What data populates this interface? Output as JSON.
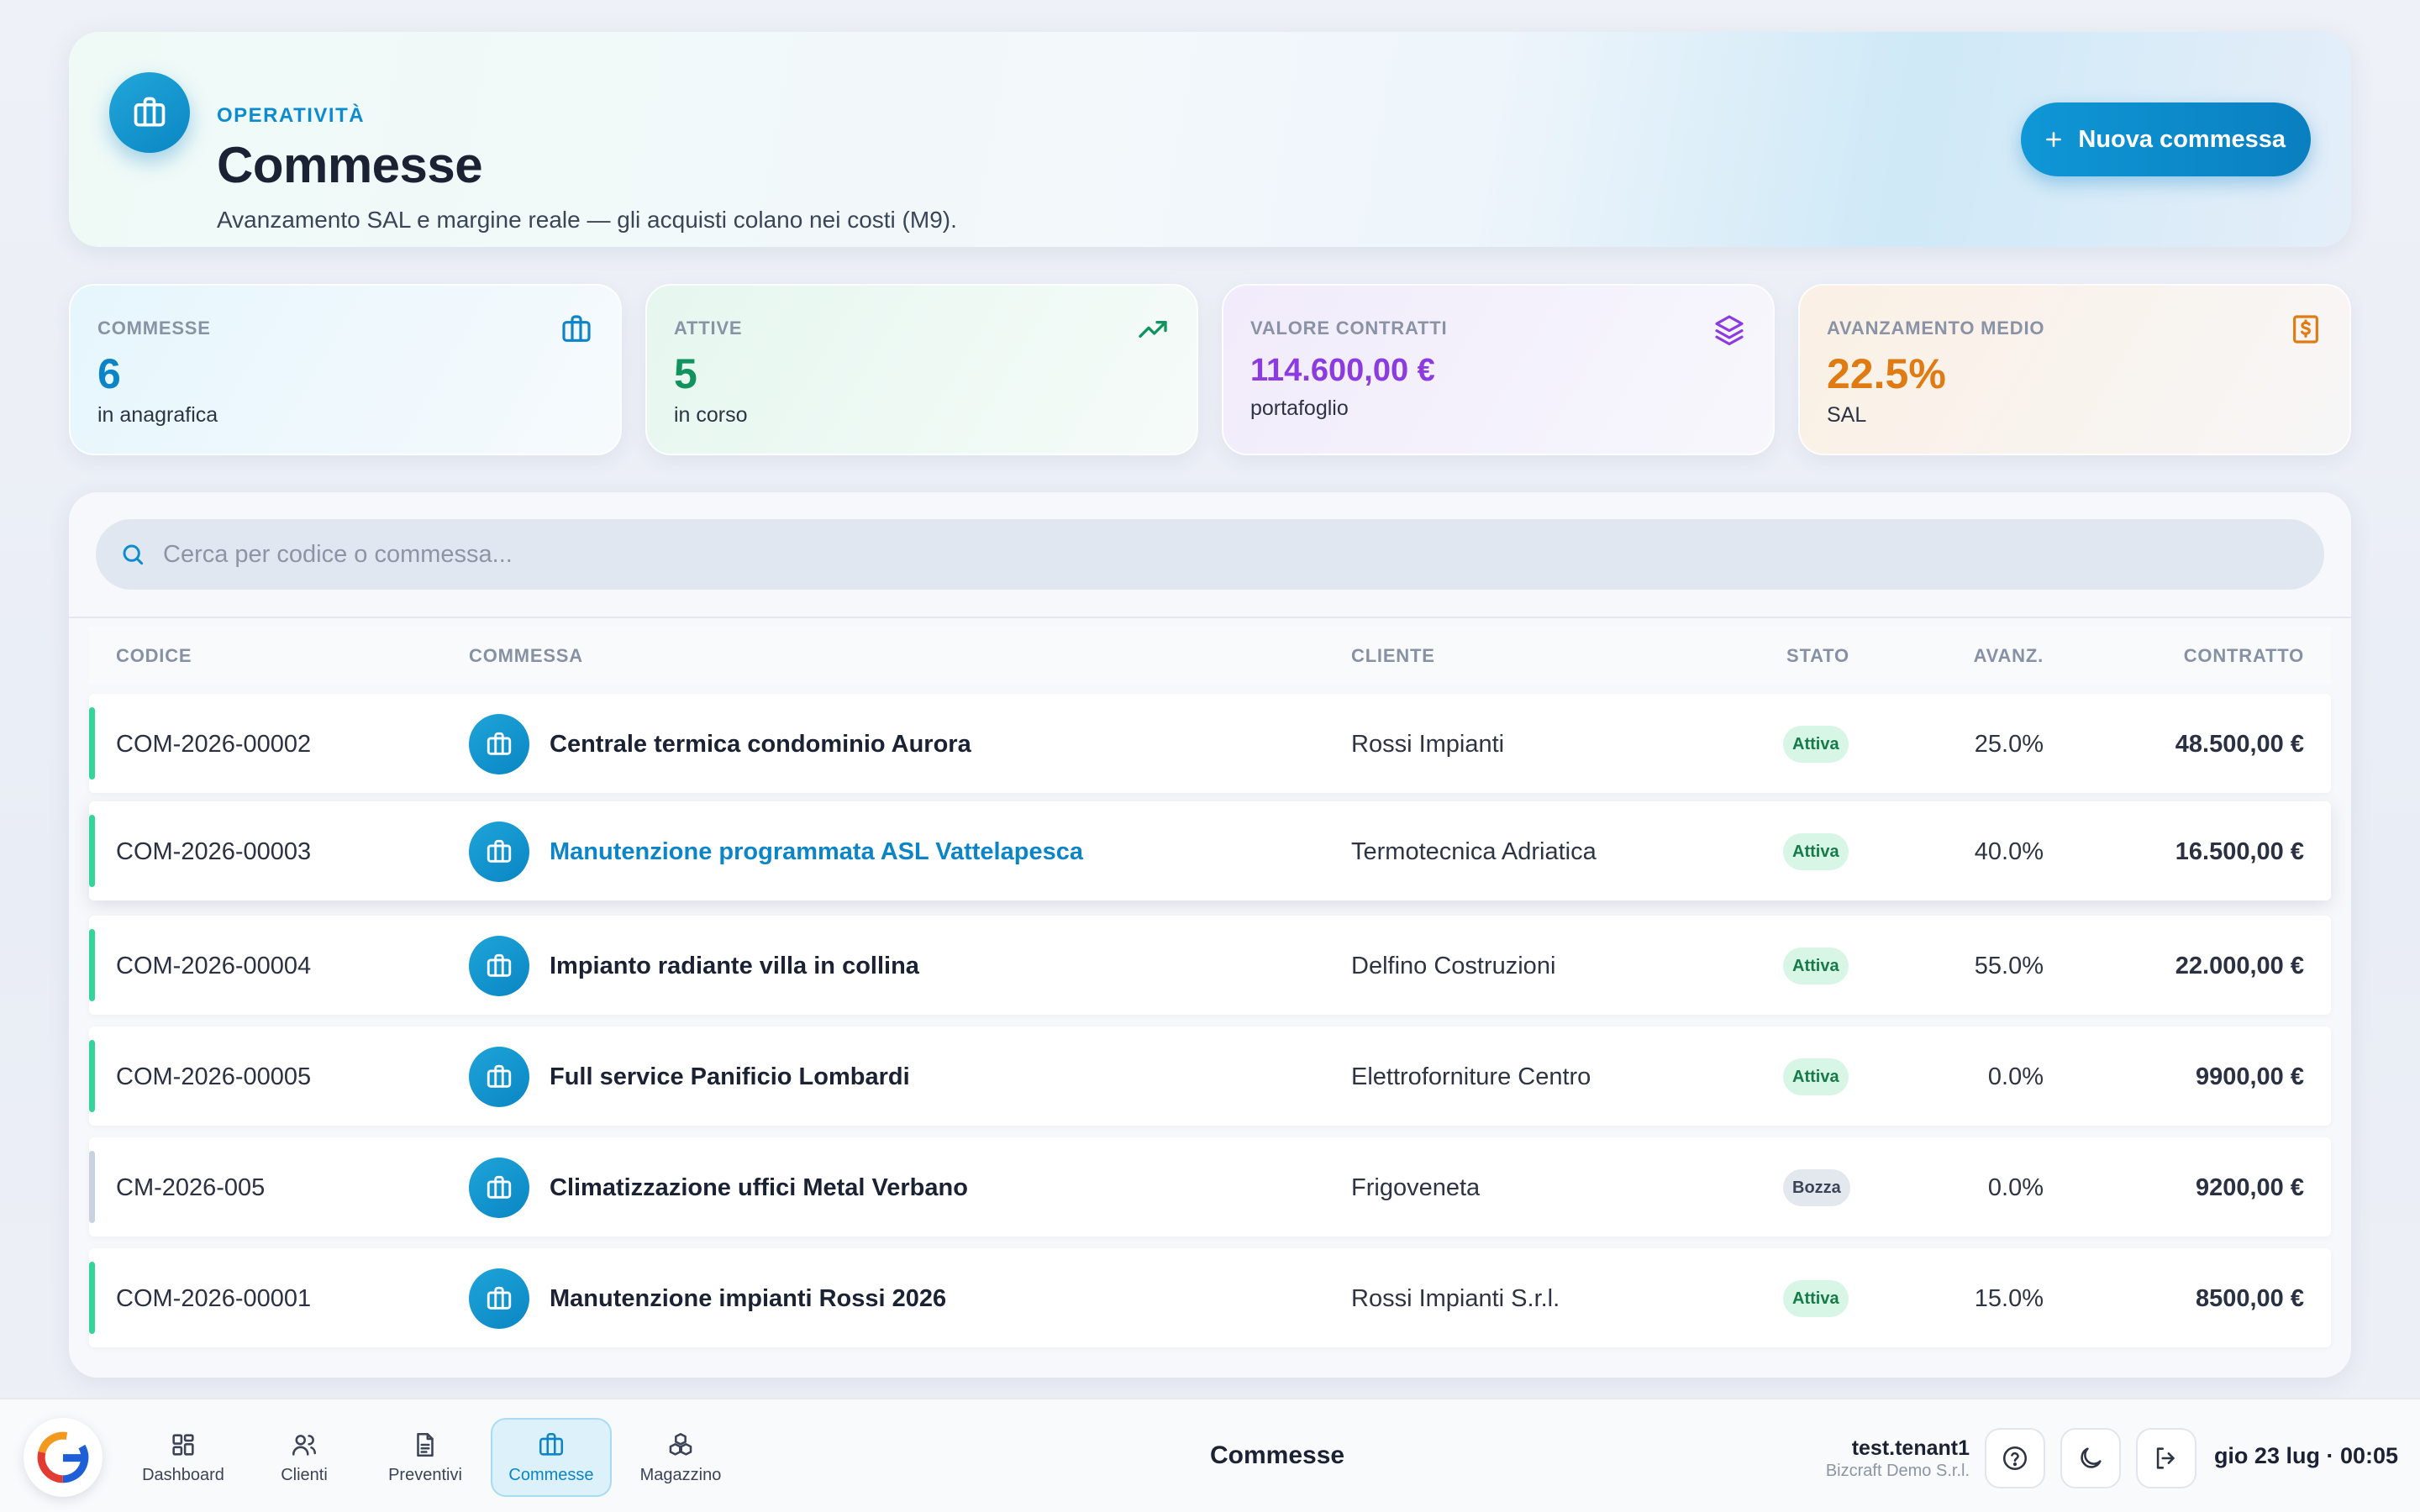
{
  "header": {
    "eyebrow": "OPERATIVITÀ",
    "title": "Commesse",
    "subtitle": "Avanzamento SAL e margine reale — gli acquisti colano nei costi (M9).",
    "new_button": "Nuova commessa",
    "icon": "briefcase-icon"
  },
  "kpis": [
    {
      "label": "COMMESSE",
      "value": "6",
      "sub": "in anagrafica",
      "icon": "briefcase-icon",
      "color": "#0b84c8"
    },
    {
      "label": "ATTIVE",
      "value": "5",
      "sub": "in corso",
      "icon": "trending-up-icon",
      "color": "#10935f"
    },
    {
      "label": "VALORE CONTRATTI",
      "value": "114.600,00 €",
      "sub": "portafoglio",
      "icon": "layers-icon",
      "color": "#8b3be0"
    },
    {
      "label": "AVANZAMENTO MEDIO",
      "value": "22.5%",
      "sub": "SAL",
      "icon": "receipt-icon",
      "color": "#e07a12"
    }
  ],
  "search": {
    "placeholder": "Cerca per codice o commessa..."
  },
  "table": {
    "columns": [
      "CODICE",
      "COMMESSA",
      "CLIENTE",
      "STATO",
      "AVANZ.",
      "CONTRATTO"
    ],
    "rows": [
      {
        "code": "COM-2026-00002",
        "name": "Centrale termica condominio Aurora",
        "client": "Rossi Impianti",
        "status": "Attiva",
        "progress": "25.0%",
        "contract": "48.500,00 €"
      },
      {
        "code": "COM-2026-00003",
        "name": "Manutenzione programmata ASL Vattelapesca",
        "client": "Termotecnica Adriatica",
        "status": "Attiva",
        "progress": "40.0%",
        "contract": "16.500,00 €"
      },
      {
        "code": "COM-2026-00004",
        "name": "Impianto radiante villa in collina",
        "client": "Delfino Costruzioni",
        "status": "Attiva",
        "progress": "55.0%",
        "contract": "22.000,00 €"
      },
      {
        "code": "COM-2026-00005",
        "name": "Full service Panificio Lombardi",
        "client": "Elettroforniture Centro",
        "status": "Attiva",
        "progress": "0.0%",
        "contract": "9900,00 €"
      },
      {
        "code": "CM-2026-005",
        "name": "Climatizzazione uffici Metal Verbano",
        "client": "Frigoveneta",
        "status": "Bozza",
        "progress": "0.0%",
        "contract": "9200,00 €"
      },
      {
        "code": "COM-2026-00001",
        "name": "Manutenzione impianti Rossi 2026",
        "client": "Rossi Impianti S.r.l.",
        "status": "Attiva",
        "progress": "15.0%",
        "contract": "8500,00 €"
      }
    ]
  },
  "nav": {
    "items": [
      {
        "label": "Dashboard",
        "icon": "grid-icon"
      },
      {
        "label": "Clienti",
        "icon": "users-icon"
      },
      {
        "label": "Preventivi",
        "icon": "document-icon"
      },
      {
        "label": "Commesse",
        "icon": "briefcase-icon"
      },
      {
        "label": "Magazzino",
        "icon": "boxes-icon"
      }
    ],
    "active": "Commesse",
    "page_title": "Commesse"
  },
  "user": {
    "name": "test.tenant1",
    "org": "Bizcraft Demo S.r.l."
  },
  "clock": "gio 23 lug · 00:05",
  "colors": {
    "accent": "#0c8bd0",
    "active_badge_bg": "#d8f6e6",
    "active_badge_text": "#177a49",
    "draft_badge_bg": "#e3e8ef",
    "status_bar_active": "#35d49a",
    "status_bar_draft": "#c9d2de"
  }
}
